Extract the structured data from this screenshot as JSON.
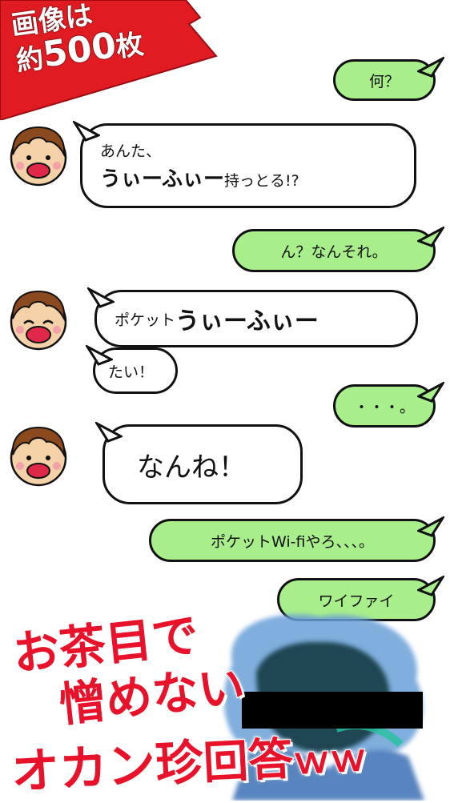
{
  "badge": {
    "line1": "画像は",
    "line2_prefix": "約",
    "line2_num": "500",
    "line2_suffix": "枚"
  },
  "messages": [
    {
      "side": "right",
      "text": "何？"
    },
    {
      "side": "left",
      "line1": "あんた、",
      "line2_big": "うぃーふぃー",
      "line2_small": "持っとる!?"
    },
    {
      "side": "right",
      "text": "ん？なんそれ。"
    },
    {
      "side": "left",
      "small": "ポケット",
      "big": "うぃーふぃー"
    },
    {
      "side": "left",
      "text": "たい！"
    },
    {
      "side": "right",
      "text": "・・・。"
    },
    {
      "side": "left",
      "text": "なんね！"
    },
    {
      "side": "right",
      "text": "ポケットWi-fiやろ、、、。"
    },
    {
      "side": "right",
      "text": "ワイファイ"
    }
  ],
  "caption": {
    "line1": "お茶目で",
    "line2": "憎めない",
    "line3a": "オカン珍",
    "line3b": "回答",
    "line3c": "ｗｗ"
  },
  "colors": {
    "green": "#a8ee8a",
    "red": "#e8122a",
    "badge": "#e11b22"
  }
}
